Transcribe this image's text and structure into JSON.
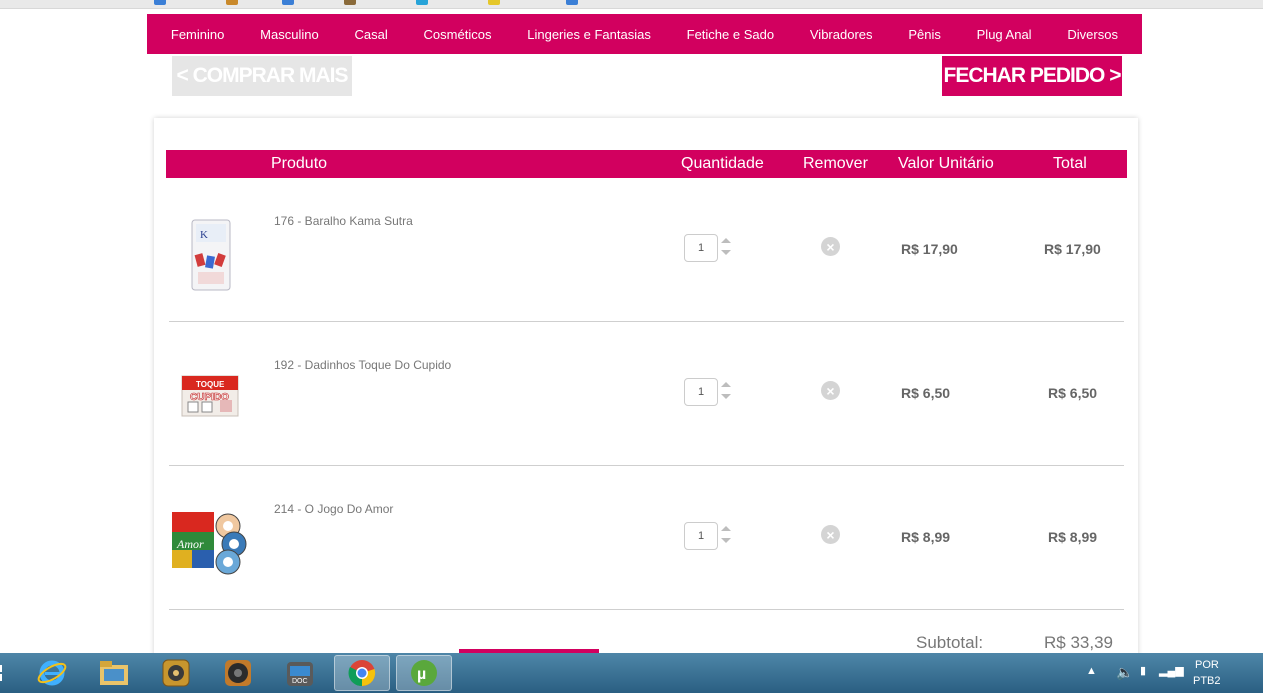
{
  "nav": {
    "items": [
      "Feminino",
      "Masculino",
      "Casal",
      "Cosméticos",
      "Lingeries e Fantasias",
      "Fetiche e Sado",
      "Vibradores",
      "Pênis",
      "Plug Anal",
      "Diversos"
    ]
  },
  "actions": {
    "continue_label": "< COMPRAR MAIS",
    "checkout_label": "FECHAR PEDIDO >"
  },
  "cart": {
    "headers": {
      "product": "Produto",
      "quantity": "Quantidade",
      "remove": "Remover",
      "unit_price": "Valor Unitário",
      "total": "Total"
    },
    "items": [
      {
        "name": "176 - Baralho Kama Sutra",
        "quantity": "1",
        "unit_price": "R$ 17,90",
        "total": "R$ 17,90"
      },
      {
        "name": "192 - Dadinhos Toque Do Cupido",
        "quantity": "1",
        "unit_price": "R$ 6,50",
        "total": "R$ 6,50"
      },
      {
        "name": "214 - O Jogo Do Amor",
        "quantity": "1",
        "unit_price": "R$ 8,99",
        "total": "R$ 8,99"
      }
    ],
    "subtotal_label": "Subtotal:",
    "subtotal_value": "R$ 33,39"
  },
  "taskbar": {
    "language": "POR",
    "layout": "PTB2",
    "apps": [
      "start-icon",
      "internet-explorer-icon",
      "file-explorer-icon",
      "media-app-icon",
      "speaker-app-icon",
      "document-app-icon",
      "chrome-icon",
      "utorrent-icon"
    ]
  },
  "colors": {
    "brand": "#d2005f",
    "muted_button": "#e6e6e6"
  }
}
